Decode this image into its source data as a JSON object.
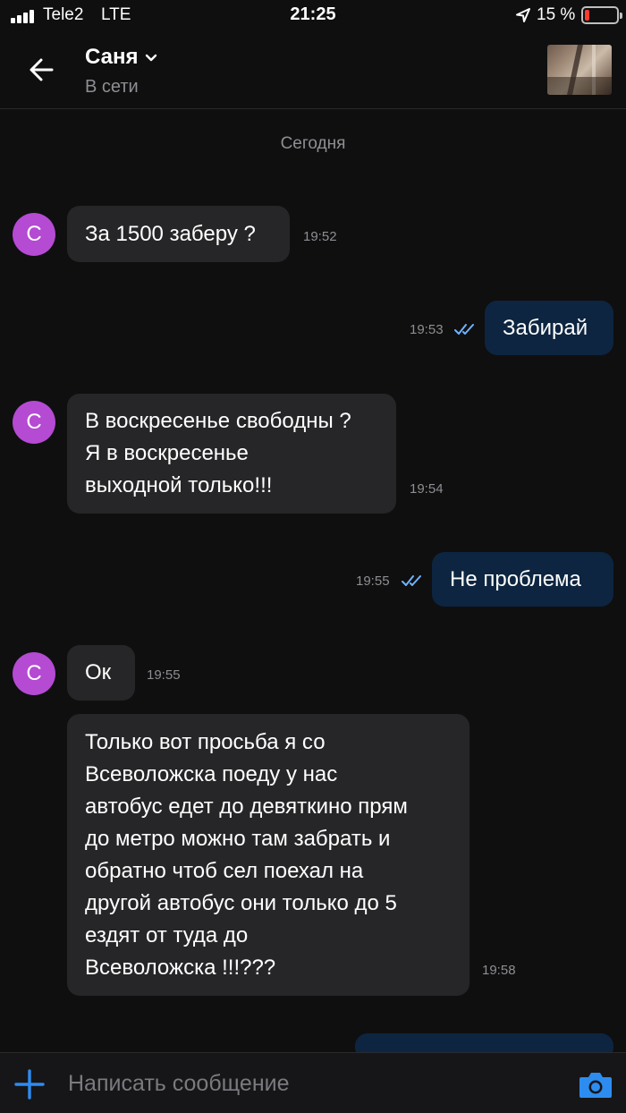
{
  "status_bar": {
    "carrier": "Tele2",
    "network": "LTE",
    "time": "21:25",
    "battery": "15 %"
  },
  "header": {
    "back_icon": "arrow-left-icon",
    "contact_name": "Саня",
    "contact_status": "В сети",
    "avatar_icon": "contact-photo"
  },
  "chat": {
    "day_label": "Сегодня",
    "messages": [
      {
        "direction": "in",
        "text": "За 1500 заберу ?",
        "time": "19:52",
        "avatar": "С"
      },
      {
        "direction": "out",
        "text": "Забирай",
        "time": "19:53",
        "read": true
      },
      {
        "direction": "in",
        "text": "В воскресенье свободны ?\nЯ в воскресенье\nвыходной только!!!",
        "time": "19:54",
        "avatar": "С"
      },
      {
        "direction": "out",
        "text": "Не проблема",
        "time": "19:55",
        "read": true
      },
      {
        "direction": "in",
        "text": "Ок",
        "time": "19:55",
        "avatar": "С"
      },
      {
        "direction": "in",
        "text": "Только вот просьба я со\nВсеволожска поеду  у нас\nавтобус едет до девяткино прям\nдо метро можно там забрать и\nобратно чтоб сел поехал на\nдругой автобус они только до 5\nездят от туда до\nВсеволожска !!!???",
        "time": "19:58"
      }
    ]
  },
  "input": {
    "placeholder": "Написать сообщение",
    "value": "",
    "plus_icon": "plus-icon",
    "camera_icon": "camera-icon"
  },
  "colors": {
    "background": "#0f0f10",
    "incoming_bubble": "#262628",
    "outgoing_bubble": "#0d2540",
    "avatar": "#b54ad3",
    "accent": "#2d8cf0",
    "read_ticks": "#6fb3ff"
  }
}
